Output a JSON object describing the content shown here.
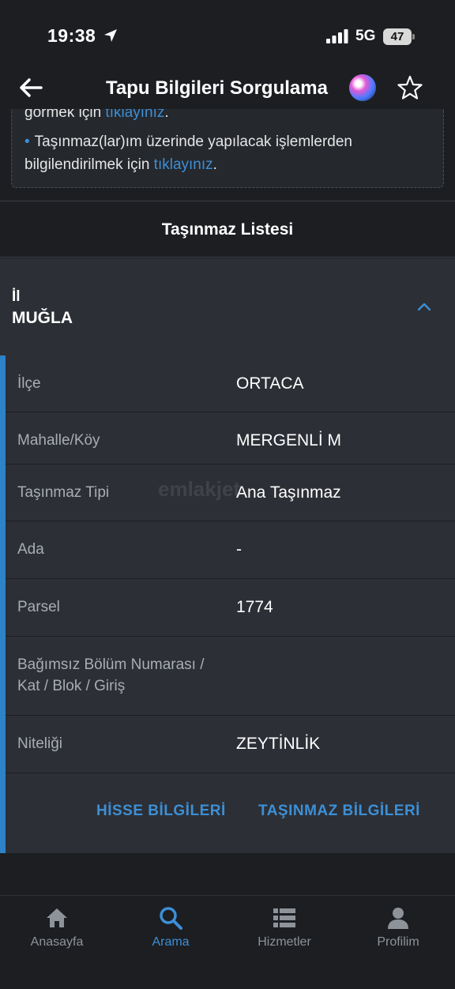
{
  "status_bar": {
    "time": "19:38",
    "network": "5G",
    "battery": "47"
  },
  "nav": {
    "title": "Tapu Bilgileri Sorgulama"
  },
  "info": {
    "line1_text": "görmek için ",
    "line1_link": "tıklayınız",
    "line1_end": ".",
    "line2_text": "Taşınmaz(lar)ım üzerinde yapılacak işlemlerden",
    "line3_text": "bilgilendirilmek için ",
    "line3_link": "tıklayınız",
    "line3_end": "."
  },
  "section": {
    "title": "Taşınmaz Listesi"
  },
  "il": {
    "label": "İl",
    "value": "MUĞLA"
  },
  "details": [
    {
      "label": "İlçe",
      "value": "ORTACA"
    },
    {
      "label": "Mahalle/Köy",
      "value": "MERGENLİ M"
    },
    {
      "label": "Taşınmaz Tipi",
      "value": "Ana Taşınmaz"
    },
    {
      "label": "Ada",
      "value": "-"
    },
    {
      "label": "Parsel",
      "value": "1774"
    },
    {
      "label_line1": "Bağımsız Bölüm Numarası /",
      "label_line2": "Kat / Blok / Giriş",
      "value": ""
    },
    {
      "label": "Niteliği",
      "value": "ZEYTİNLİK"
    }
  ],
  "actions": {
    "share_info": "HİSSE BİLGİLERİ",
    "property_info": "TAŞINMAZ BİLGİLERİ"
  },
  "tabs": [
    {
      "label": "Anasayfa",
      "icon": "home-icon"
    },
    {
      "label": "Arama",
      "icon": "search-icon"
    },
    {
      "label": "Hizmetler",
      "icon": "list-icon"
    },
    {
      "label": "Profilim",
      "icon": "person-icon"
    }
  ],
  "colors": {
    "accent": "#2d82c8",
    "link": "#3d8fd6",
    "background": "#1c1e22",
    "panel": "#2c2f35"
  },
  "watermark": "emlakjet"
}
